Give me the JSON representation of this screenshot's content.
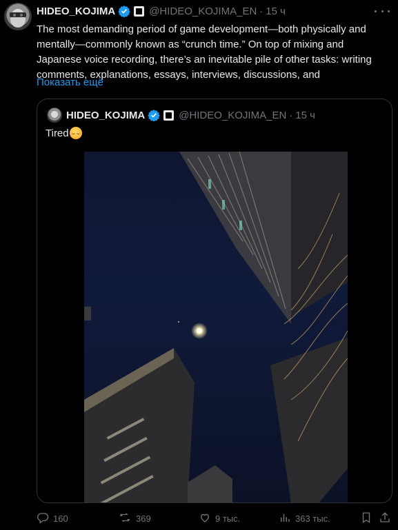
{
  "tweet": {
    "author_name": "HIDEO_KOJIMA",
    "handle": "@HIDEO_KOJIMA_EN",
    "separator": "·",
    "time": "15 ч",
    "text": "The most demanding period of game development—both physically and mentally—commonly known as “crunch time.” On top of mixing and Japanese voice recording, there’s an inevitable pile of other tasks: writing comments, explanations, essays, interviews, discussions, and",
    "show_more": "Показать ещё"
  },
  "quote": {
    "author_name": "HIDEO_KOJIMA",
    "handle": "@HIDEO_KOJIMA_EN",
    "separator": "·",
    "time": "15 ч",
    "text": "Tired"
  },
  "actions": {
    "replies": "160",
    "reposts": "369",
    "likes": "9 тыс.",
    "views": "363 тыс."
  },
  "colors": {
    "background": "#000000",
    "text": "#e7e9ea",
    "secondary": "#71767b",
    "link": "#1d9bf0",
    "verified": "#1d9bf0",
    "border": "#2f3336"
  },
  "icons": [
    "verified-badge-icon",
    "affiliate-badge-icon",
    "more-icon",
    "reply-icon",
    "repost-icon",
    "like-icon",
    "views-icon",
    "share-icon"
  ]
}
